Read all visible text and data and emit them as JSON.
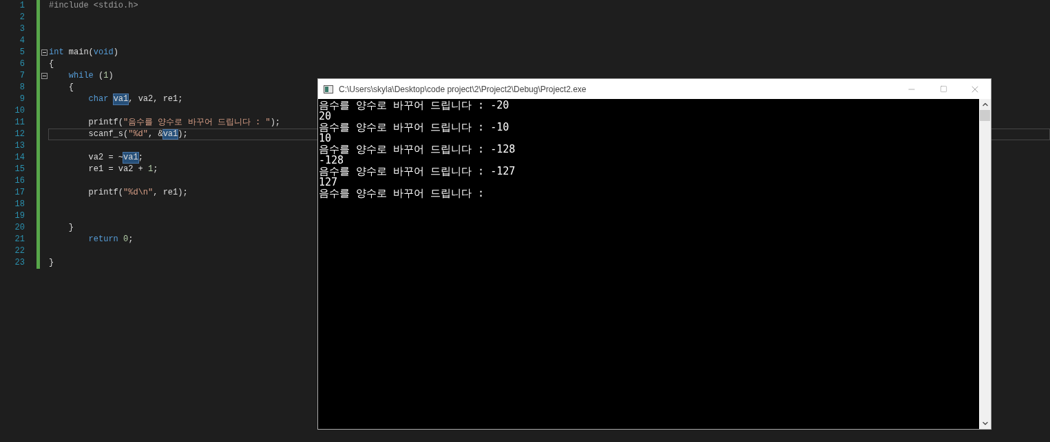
{
  "editor": {
    "lines": [
      {
        "number": "1",
        "fold": false,
        "current": false,
        "tokens": [
          {
            "t": "#include <stdio.h>",
            "kind": "pp"
          }
        ]
      },
      {
        "number": "2",
        "fold": false,
        "current": false
      },
      {
        "number": "3",
        "fold": false,
        "current": false
      },
      {
        "number": "4",
        "fold": false,
        "current": false
      },
      {
        "number": "5",
        "fold": true,
        "current": false,
        "tokens": [
          {
            "t": "int",
            "kind": "kw"
          },
          {
            "t": " main(",
            "kind": "id"
          },
          {
            "t": "void",
            "kind": "kw"
          },
          {
            "t": ")",
            "kind": "id"
          }
        ]
      },
      {
        "number": "6",
        "fold": false,
        "current": false,
        "tokens": [
          {
            "t": "{",
            "kind": "id"
          }
        ]
      },
      {
        "number": "7",
        "fold": true,
        "current": false,
        "tokens": [
          {
            "t": "    while",
            "kind": "kw"
          },
          {
            "t": " (",
            "kind": "id"
          },
          {
            "t": "1",
            "kind": "num"
          },
          {
            "t": ")",
            "kind": "id"
          }
        ]
      },
      {
        "number": "8",
        "fold": false,
        "current": false,
        "tokens": [
          {
            "t": "    {",
            "kind": "id"
          }
        ]
      },
      {
        "number": "9",
        "fold": false,
        "current": false,
        "tokens": [
          {
            "t": "        char ",
            "kind": "kw"
          },
          {
            "t": "va1",
            "kind": "hl"
          },
          {
            "t": ", va2, re1;",
            "kind": "id"
          }
        ]
      },
      {
        "number": "10",
        "fold": false,
        "current": false
      },
      {
        "number": "11",
        "fold": false,
        "current": false,
        "tokens": [
          {
            "t": "        printf(",
            "kind": "id"
          },
          {
            "t": "\"음수를 양수로 바꾸어 드립니다 : \"",
            "kind": "str"
          },
          {
            "t": ");",
            "kind": "id"
          }
        ]
      },
      {
        "number": "12",
        "fold": false,
        "current": true,
        "tokens": [
          {
            "t": "        scanf_s(",
            "kind": "id"
          },
          {
            "t": "\"%d\"",
            "kind": "str"
          },
          {
            "t": ", &",
            "kind": "id"
          },
          {
            "t": "va1",
            "kind": "hl"
          },
          {
            "t": ");",
            "kind": "id"
          }
        ]
      },
      {
        "number": "13",
        "fold": false,
        "current": false
      },
      {
        "number": "14",
        "fold": false,
        "current": false,
        "tokens": [
          {
            "t": "        va2 = ~",
            "kind": "id"
          },
          {
            "t": "va1",
            "kind": "hl"
          },
          {
            "t": ";",
            "kind": "id"
          }
        ]
      },
      {
        "number": "15",
        "fold": false,
        "current": false,
        "tokens": [
          {
            "t": "        re1 = va2 + ",
            "kind": "id"
          },
          {
            "t": "1",
            "kind": "num"
          },
          {
            "t": ";",
            "kind": "id"
          }
        ]
      },
      {
        "number": "16",
        "fold": false,
        "current": false
      },
      {
        "number": "17",
        "fold": false,
        "current": false,
        "tokens": [
          {
            "t": "        printf(",
            "kind": "id"
          },
          {
            "t": "\"%d\\n\"",
            "kind": "str"
          },
          {
            "t": ", re1);",
            "kind": "id"
          }
        ]
      },
      {
        "number": "18",
        "fold": false,
        "current": false
      },
      {
        "number": "19",
        "fold": false,
        "current": false
      },
      {
        "number": "20",
        "fold": false,
        "current": false,
        "tokens": [
          {
            "t": "    }",
            "kind": "id"
          }
        ]
      },
      {
        "number": "21",
        "fold": false,
        "current": false,
        "tokens": [
          {
            "t": "        return ",
            "kind": "kw"
          },
          {
            "t": "0",
            "kind": "num"
          },
          {
            "t": ";",
            "kind": "id"
          }
        ]
      },
      {
        "number": "22",
        "fold": false,
        "current": false
      },
      {
        "number": "23",
        "fold": false,
        "current": false,
        "tokens": [
          {
            "t": "}",
            "kind": "id"
          }
        ]
      }
    ]
  },
  "console": {
    "title": "C:\\Users\\skyla\\Desktop\\code project\\2\\Project2\\Debug\\Project2.exe",
    "output": [
      "음수를 양수로 바꾸어 드립니다 : -20",
      "20",
      "음수를 양수로 바꾸어 드립니다 : -10",
      "10",
      "음수를 양수로 바꾸어 드립니다 : -128",
      "-128",
      "음수를 양수로 바꾸어 드립니다 : -127",
      "127",
      "음수를 양수로 바꾸어 드립니다 :"
    ]
  }
}
